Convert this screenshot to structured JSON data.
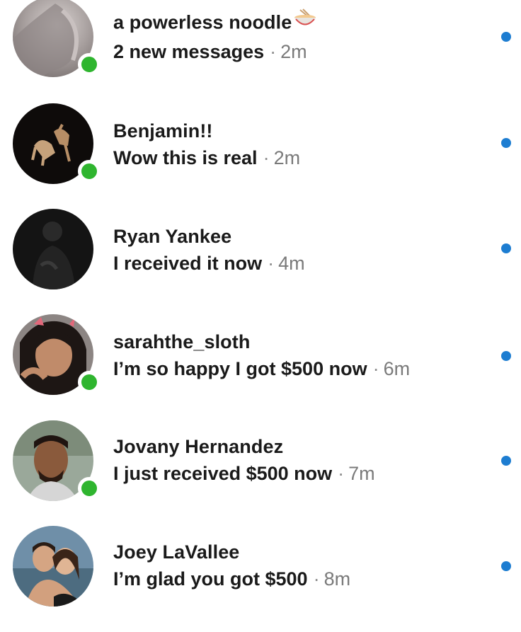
{
  "conversations": [
    {
      "name": "a powerless noodle",
      "name_emoji": "noodle-bowl-icon",
      "message": "2 new messages",
      "separator": "·",
      "time": "2m",
      "online": true,
      "unread": true
    },
    {
      "name": "Benjamin!!",
      "message": "Wow this is real",
      "separator": "·",
      "time": "2m",
      "online": true,
      "unread": true
    },
    {
      "name": "Ryan Yankee",
      "message": "I received it now",
      "separator": "·",
      "time": "4m",
      "online": false,
      "unread": true
    },
    {
      "name": "sarahthe_sloth",
      "message": "I’m so happy I got $500 now",
      "separator": "·",
      "time": "6m",
      "online": true,
      "unread": true
    },
    {
      "name": "Jovany Hernandez",
      "message": "I just received $500 now",
      "separator": "·",
      "time": "7m",
      "online": true,
      "unread": true
    },
    {
      "name": "Joey LaVallee",
      "message": "I’m glad you got $500",
      "separator": "·",
      "time": "8m",
      "online": false,
      "unread": true
    }
  ],
  "colors": {
    "online": "#2fb52f",
    "unread": "#1d7dd1",
    "time": "#7a7a7a"
  }
}
